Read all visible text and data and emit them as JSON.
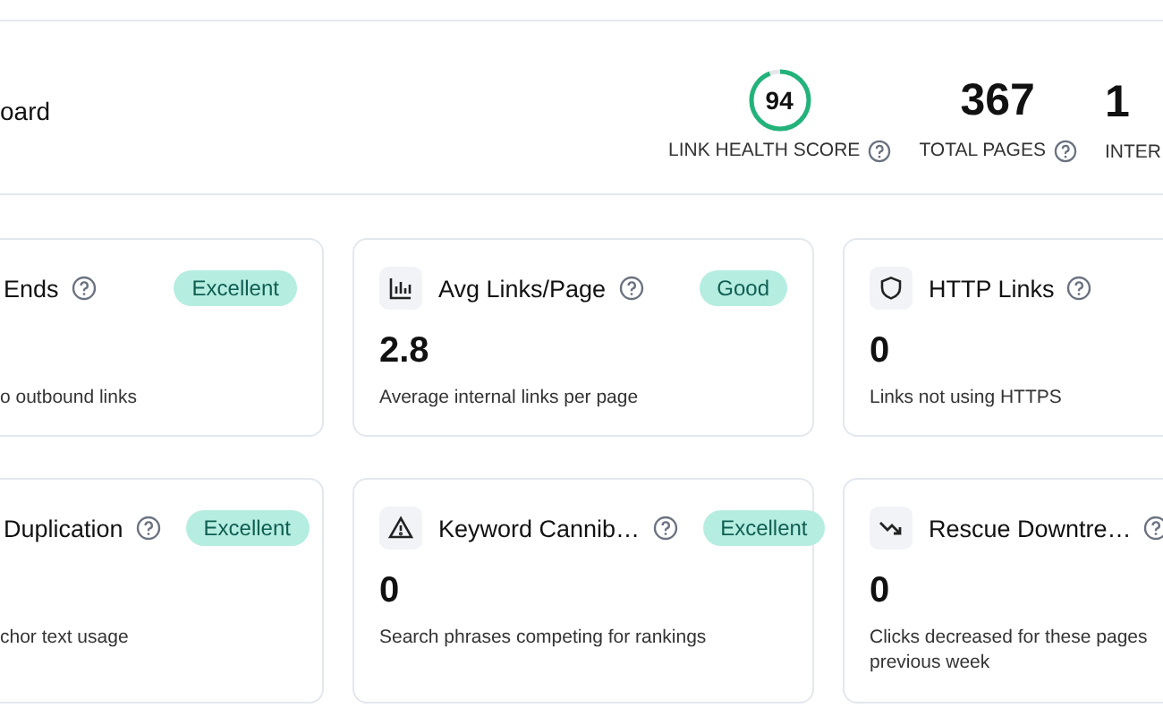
{
  "header": {
    "title": "oard",
    "metrics": [
      {
        "kind": "gauge",
        "value": "94",
        "label": "LINK HEALTH SCORE",
        "level": 0.94
      },
      {
        "kind": "number",
        "value": "367",
        "label": "TOTAL PAGES"
      },
      {
        "kind": "edge",
        "value": "1",
        "label": "INTER"
      }
    ]
  },
  "cards": [
    {
      "kind": "plain",
      "title": "Ends",
      "description": "o outbound links",
      "status": "Excellent"
    },
    {
      "kind": "bars",
      "title": "Avg Links/Page",
      "value": "2.8",
      "description": "Average internal links per page",
      "status": "Good"
    },
    {
      "kind": "shield",
      "title": "HTTP Links",
      "value": "0",
      "description": "Links not using HTTPS"
    },
    {
      "kind": "plain",
      "title": "Duplication",
      "description": "chor text usage",
      "status": "Excellent"
    },
    {
      "kind": "warning",
      "title": "Keyword Cannib…",
      "value": "0",
      "description": "Search phrases competing for rankings",
      "status": "Excellent"
    },
    {
      "kind": "trend",
      "title": "Rescue Downtre…",
      "value": "0",
      "description": "Clicks decreased for these pages\nprevious week"
    }
  ]
}
